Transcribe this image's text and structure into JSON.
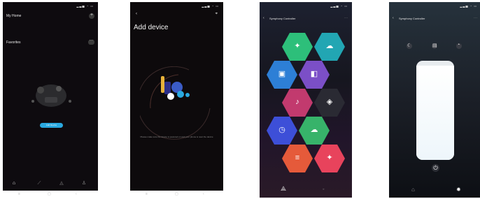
{
  "screen1": {
    "title": "My Home",
    "section": "Favorites",
    "button_label": "Add Device"
  },
  "screen2": {
    "title": "Add device",
    "subtitle": "",
    "hint": "Please make sure the device is powered on and your phone is near the device"
  },
  "screen3": {
    "title": "Symphony Controller",
    "hexagons": [
      {
        "name": "hex-1",
        "color": "#2dbf7a",
        "glyph": "✦"
      },
      {
        "name": "hex-2",
        "color": "#22a6b3",
        "glyph": "☁"
      },
      {
        "name": "hex-3",
        "color": "#2d7fd6",
        "glyph": "▣"
      },
      {
        "name": "hex-4",
        "color": "#7b4fc7",
        "glyph": "◧"
      },
      {
        "name": "hex-5",
        "color": "#c23a6e",
        "glyph": "♪"
      },
      {
        "name": "hex-6",
        "color": "#2a2a33",
        "glyph": "◈"
      },
      {
        "name": "hex-7",
        "color": "#3d4fd8",
        "glyph": "◷"
      },
      {
        "name": "hex-8",
        "color": "#37b36a",
        "glyph": "☁"
      },
      {
        "name": "hex-9",
        "color": "#e55a3a",
        "glyph": "≡"
      },
      {
        "name": "hex-10",
        "color": "#e8435c",
        "glyph": "✦"
      }
    ]
  },
  "screen4": {
    "title": "Symphony Controller",
    "brightness_percent": 95
  },
  "colors": {
    "accent": "#2aa9e0",
    "dark_bg": "#0e0b0f"
  }
}
